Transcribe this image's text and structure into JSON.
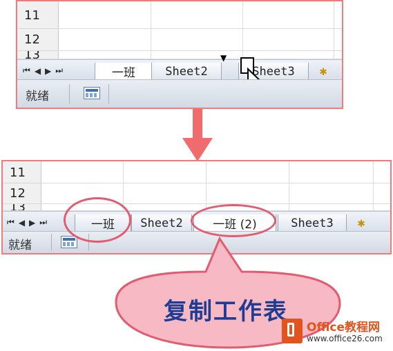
{
  "top_panel": {
    "rows": [
      "11",
      "12",
      "13"
    ],
    "tabs": [
      "一班",
      "Sheet2",
      "Sheet3"
    ],
    "nav_icons": [
      "first-sheet-icon",
      "prev-sheet-icon",
      "next-sheet-icon",
      "last-sheet-icon"
    ],
    "status_text": "就绪"
  },
  "bottom_panel": {
    "rows": [
      "11",
      "12",
      "13"
    ],
    "tabs": [
      "一班",
      "Sheet2",
      "一班 (2)",
      "Sheet3"
    ],
    "status_text": "就绪"
  },
  "callout": {
    "text": "复制工作表"
  },
  "watermark": {
    "title": "Office教程网",
    "url": "www.office26.com"
  },
  "colors": {
    "highlight": "#e25b6f",
    "callout_fill": "#f7b9c3",
    "callout_text": "#1f3c94",
    "arrow": "#f06b6b",
    "logo": "#e2541f"
  }
}
